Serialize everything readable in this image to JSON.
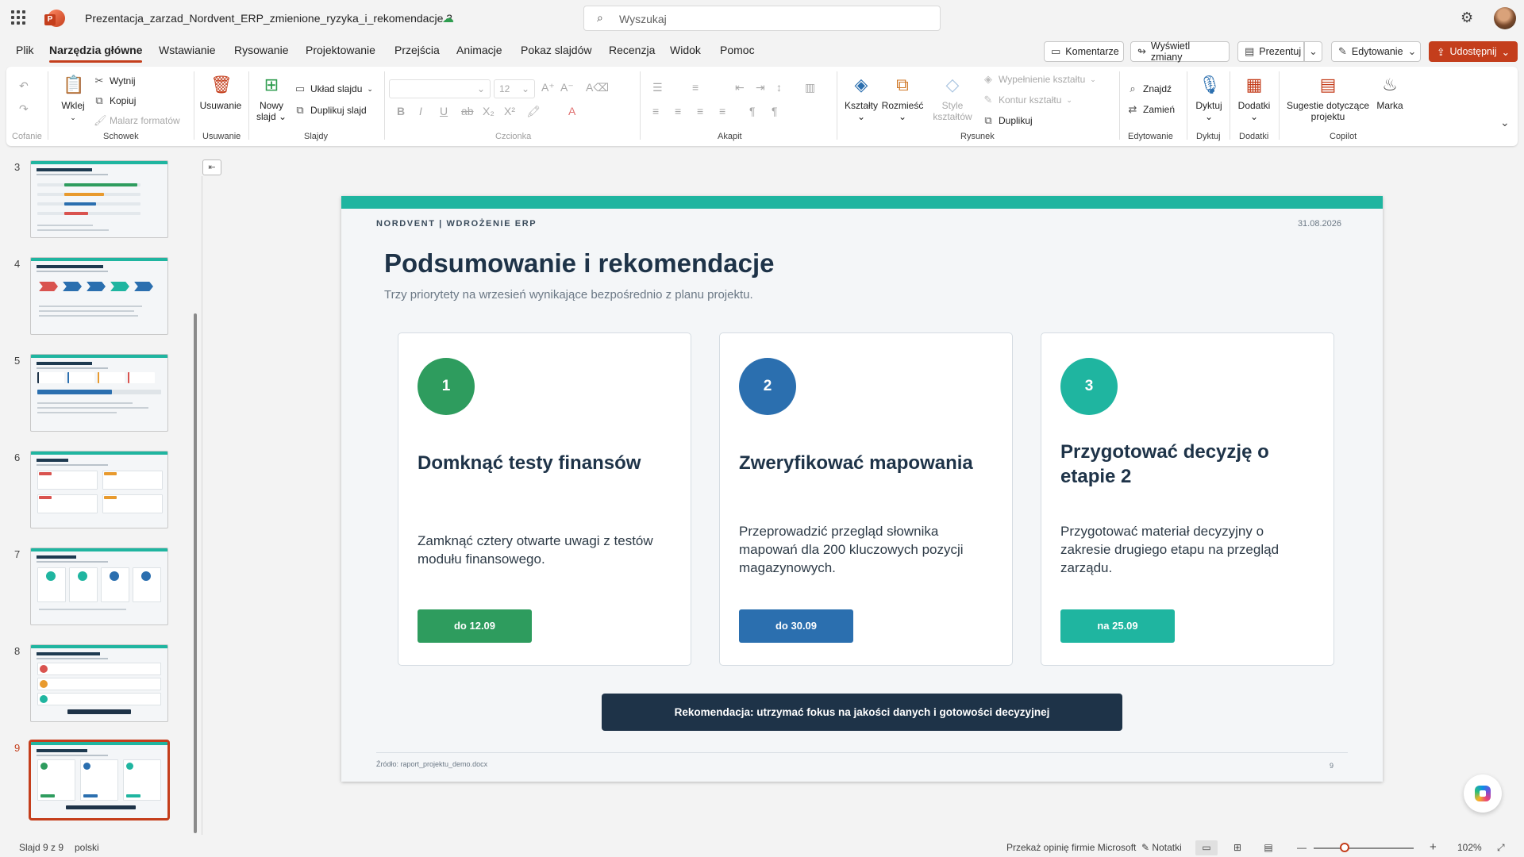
{
  "titlebar": {
    "document_title": "Prezentacja_zarzad_Nordvent_ERP_zmienione_ryzyka_i_rekomendacje 3",
    "search_placeholder": "Wyszukaj"
  },
  "tabs": [
    {
      "label": "Plik"
    },
    {
      "label": "Narzędzia główne"
    },
    {
      "label": "Wstawianie"
    },
    {
      "label": "Rysowanie"
    },
    {
      "label": "Projektowanie"
    },
    {
      "label": "Przejścia"
    },
    {
      "label": "Animacje"
    },
    {
      "label": "Pokaz slajdów"
    },
    {
      "label": "Recenzja"
    },
    {
      "label": "Widok"
    },
    {
      "label": "Pomoc"
    }
  ],
  "actions": {
    "comments": "Komentarze",
    "show_changes": "Wyświetl zmiany",
    "present": "Prezentuj",
    "editing": "Edytowanie",
    "share": "Udostępnij"
  },
  "ribbon": {
    "undo_group": "Cofanie",
    "paste": "Wklej",
    "cut": "Wytnij",
    "copy": "Kopiuj",
    "format_painter": "Malarz formatów",
    "clipboard_group": "Schowek",
    "delete": "Usuwanie",
    "delete_group": "Usuwanie",
    "new_slide": "Nowy slajd",
    "layout": "Układ slajdu",
    "duplicate_slide": "Duplikuj slajd",
    "slides_group": "Slajdy",
    "font_size": "12",
    "font_group": "Czcionka",
    "paragraph_group": "Akapit",
    "shapes": "Kształty",
    "arrange": "Rozmieść",
    "shape_styles": "Style kształtów",
    "shape_fill": "Wypełnienie kształtu",
    "shape_outline": "Kontur kształtu",
    "duplicate": "Duplikuj",
    "drawing_group": "Rysunek",
    "find": "Znajdź",
    "replace": "Zamień",
    "editing_group": "Edytowanie",
    "dictate": "Dyktuj",
    "dictate_group": "Dyktuj",
    "addins": "Dodatki",
    "addins_group": "Dodatki",
    "suggestions": "Sugestie dotyczące projektu",
    "brand": "Marka",
    "copilot_group": "Copilot"
  },
  "thumbnails": [
    {
      "number": "3"
    },
    {
      "number": "4"
    },
    {
      "number": "5"
    },
    {
      "number": "6"
    },
    {
      "number": "7"
    },
    {
      "number": "8"
    },
    {
      "number": "9"
    }
  ],
  "slide": {
    "kicker": "NORDVENT  |  WDROŻENIE ERP",
    "date": "31.08.2026",
    "title": "Podsumowanie i rekomendacje",
    "subtitle": "Trzy priorytety na wrzesień wynikające bezpośrednio z planu projektu.",
    "cards": [
      {
        "number": "1",
        "title": "Domknąć testy finansów",
        "text": "Zamknąć cztery otwarte uwagi z testów modułu finansowego.",
        "deadline": "do 12.09",
        "color": "#2e9c5e"
      },
      {
        "number": "2",
        "title": "Zweryfikować mapowania",
        "text": "Przeprowadzić przegląd słownika mapowań dla 200 kluczowych pozycji magazynowych.",
        "deadline": "do 30.09",
        "color": "#2b6faf"
      },
      {
        "number": "3",
        "title": "Przygotować decyzję o etapie 2",
        "text": "Przygotować materiał decyzyjny o zakresie drugiego etapu na przegląd zarządu.",
        "deadline": "na 25.09",
        "color": "#1fb5a0"
      }
    ],
    "recommendation": "Rekomendacja: utrzymać fokus na jakości danych i gotowości decyzyjnej",
    "source": "Źródło: raport_projektu_demo.docx",
    "page": "9"
  },
  "status": {
    "slide_counter": "Slajd 9 z 9",
    "language": "polski",
    "feedback": "Przekaż opinię firmie Microsoft",
    "notes": "Notatki",
    "zoom": "102%"
  },
  "colors": {
    "accent": "#c43e1c",
    "teal": "#1fb5a0",
    "navy": "#1e3348"
  }
}
